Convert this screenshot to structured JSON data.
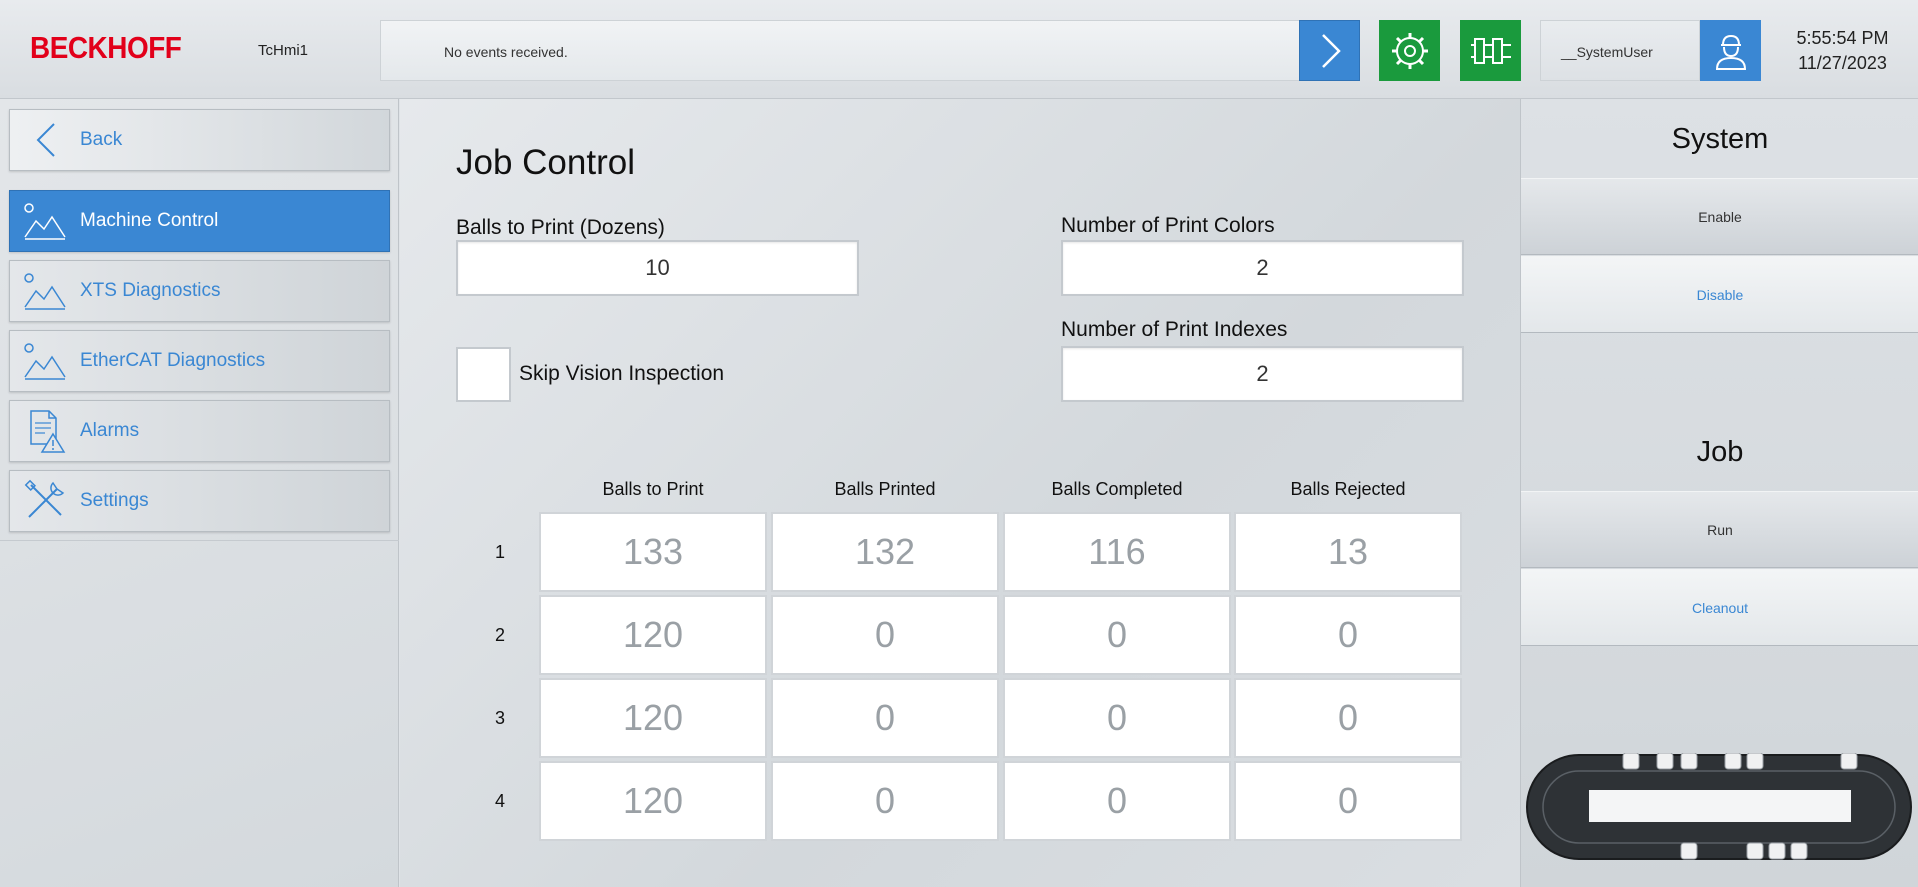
{
  "header": {
    "logo": "BECKHOFF",
    "app_name": "TcHmi1",
    "events_text": "No events received.",
    "user": "__SystemUser",
    "time": "5:55:54 PM",
    "date": "11/27/2023",
    "icons": [
      "chevron-right-icon",
      "gear-wrench-icon",
      "xts-module-icon",
      "user-icon"
    ],
    "colors": {
      "accent": "#3a87d3",
      "green": "#1a9a3d",
      "logo_red": "#e2001a"
    }
  },
  "sidebar": {
    "back_label": "Back",
    "items": [
      {
        "label": "Machine Control",
        "icon": "image-placeholder-icon",
        "active": true
      },
      {
        "label": "XTS Diagnostics",
        "icon": "image-placeholder-icon",
        "active": false
      },
      {
        "label": "EtherCAT Diagnostics",
        "icon": "image-placeholder-icon",
        "active": false
      },
      {
        "label": "Alarms",
        "icon": "alarm-document-icon",
        "active": false
      },
      {
        "label": "Settings",
        "icon": "tools-icon",
        "active": false
      }
    ]
  },
  "main": {
    "title": "Job Control",
    "balls_to_print_label": "Balls to Print (Dozens)",
    "balls_to_print_value": "10",
    "print_colors_label": "Number of Print Colors",
    "print_colors_value": "2",
    "print_indexes_label": "Number of Print Indexes",
    "print_indexes_value": "2",
    "skip_vision_label": "Skip Vision Inspection",
    "skip_vision_checked": false,
    "table": {
      "columns": [
        "Balls to Print",
        "Balls Printed",
        "Balls Completed",
        "Balls Rejected"
      ],
      "rows": [
        {
          "label": "1",
          "cells": [
            "133",
            "132",
            "116",
            "13"
          ]
        },
        {
          "label": "2",
          "cells": [
            "120",
            "0",
            "0",
            "0"
          ]
        },
        {
          "label": "3",
          "cells": [
            "120",
            "0",
            "0",
            "0"
          ]
        },
        {
          "label": "4",
          "cells": [
            "120",
            "0",
            "0",
            "0"
          ]
        }
      ]
    }
  },
  "right_panel": {
    "system_title": "System",
    "enable_label": "Enable",
    "disable_label": "Disable",
    "job_title": "Job",
    "run_label": "Run",
    "cleanout_label": "Cleanout"
  }
}
